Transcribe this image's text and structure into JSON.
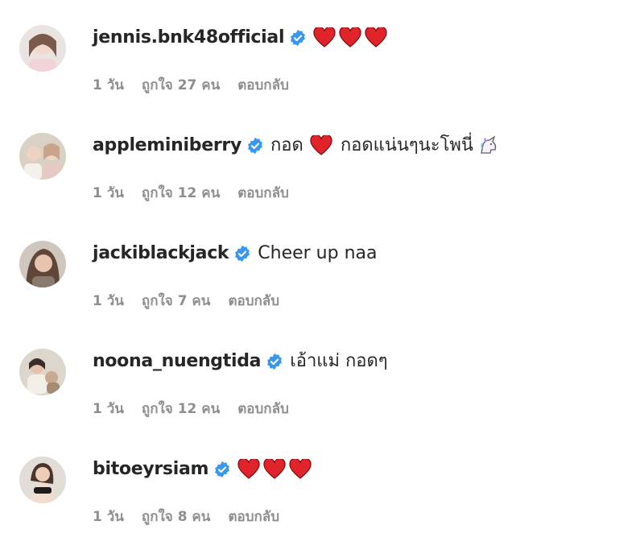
{
  "comments": [
    {
      "username": "jennis.bnk48official",
      "text": "",
      "hearts": 3,
      "unicorn": false,
      "time": "1 วัน",
      "likes": "ถูกใจ 27 คน",
      "reply": "ตอบกลับ"
    },
    {
      "username": "appleminiberry",
      "text_before": "กอด",
      "text": "กอดแน่นๆนะโพนี่",
      "hearts": 1,
      "unicorn": true,
      "time": "1 วัน",
      "likes": "ถูกใจ 12 คน",
      "reply": "ตอบกลับ"
    },
    {
      "username": "jackiblackjack",
      "text": "Cheer up naa",
      "hearts": 0,
      "unicorn": false,
      "time": "1 วัน",
      "likes": "ถูกใจ 7 คน",
      "reply": "ตอบกลับ"
    },
    {
      "username": "noona_nuengtida",
      "text": "เอ้าแม่ กอดๆ",
      "hearts": 0,
      "unicorn": false,
      "time": "1 วัน",
      "likes": "ถูกใจ 12 คน",
      "reply": "ตอบกลับ"
    },
    {
      "username": "bitoeyrsiam",
      "text": "",
      "hearts": 3,
      "unicorn": false,
      "time": "1 วัน",
      "likes": "ถูกใจ 8 คน",
      "reply": "ตอบกลับ"
    }
  ],
  "icons": {
    "verified": "verified-badge-icon",
    "heart": "red-heart-icon",
    "unicorn": "unicorn-icon"
  },
  "colors": {
    "verified": "#3897f0",
    "heart": "#e0242a",
    "meta": "#8e8e8e",
    "username": "#262626"
  }
}
